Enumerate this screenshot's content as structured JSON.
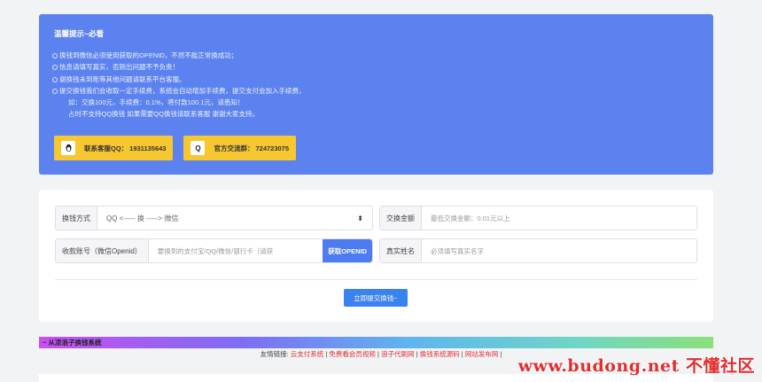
{
  "notice": {
    "title": "温馨提示~必看",
    "tips": [
      "换钱到微信必须使用获取的OPENID，不然不能正常换成功；",
      "信息请填写真实，否则出问题不予负责！",
      "谢换钱未到账等其他问题请联系平台客服。",
      "提交换钱我们会收取一定手续费，系统会自动增加手续费，提交支付会加入手续费，",
      "如：交换100元，手续费：0.1%，将付款100.1元，请悉知！",
      "占时不支持QQ换钱 如果需要QQ换钱请联系客服 谢谢大家支持。"
    ],
    "contact_qq_label": "联系客服QQ：",
    "contact_qq_number": "1931135643",
    "group_label": "官方交流群：",
    "group_number": "724723075",
    "group_icon_char": "Q"
  },
  "form": {
    "method_label": "换钱方式",
    "method_value": "QQ  <----- 换 ----->  微信",
    "amount_label": "交换金额",
    "amount_placeholder": "最低交换金额：0.01元以上",
    "account_label": "收款账号（微信Openid）",
    "account_placeholder": "要换到的支付宝/QQ/微信/银行卡（请获",
    "openid_button": "获取OPENID",
    "name_label": "真实姓名",
    "name_placeholder": "必须填写真实名字",
    "submit_label": "立即提交换钱~"
  },
  "footer": {
    "marquee": "~ 从凉浪子换钱系统",
    "links_prefix": "友情链接:",
    "links": [
      "云支付系统",
      "免费看会员视频",
      "浪子代刷网",
      "换钱系统源码",
      "网站发布网"
    ],
    "separator": "|"
  },
  "watermark": "www.budong.net 不懂社区",
  "colors": {
    "notice_bg": "#5b82ef",
    "badge_bg": "#f7c731",
    "primary": "#3a82f0",
    "link": "#e0303a"
  }
}
